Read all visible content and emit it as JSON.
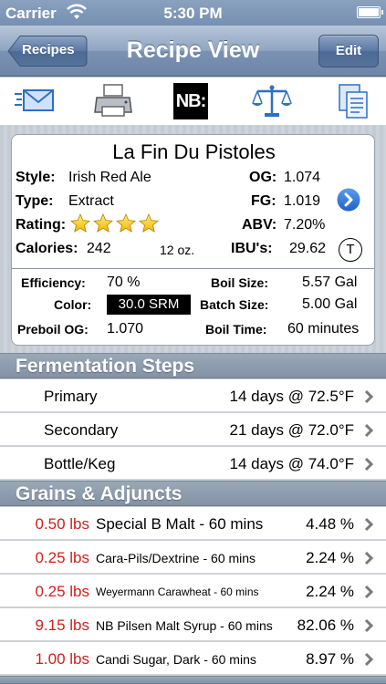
{
  "status": {
    "carrier": "Carrier",
    "time": "5:30 PM"
  },
  "nav": {
    "back_label": "Recipes",
    "title": "Recipe View",
    "edit_label": "Edit"
  },
  "toolbar": {
    "icons": [
      "mail-icon",
      "printer-icon",
      "nb-logo-icon",
      "scale-icon",
      "copy-icon"
    ],
    "nb_text": "NB:"
  },
  "recipe": {
    "name": "La Fin Du Pistoles",
    "style_label": "Style:",
    "style": "Irish Red Ale",
    "type_label": "Type:",
    "type": "Extract",
    "rating_label": "Rating:",
    "rating": 4,
    "calories_label": "Calories:",
    "calories": "242",
    "serving": "12 oz.",
    "og_label": "OG:",
    "og": "1.074",
    "fg_label": "FG:",
    "fg": "1.019",
    "abv_label": "ABV:",
    "abv": "7.20%",
    "ibu_label": "IBU's:",
    "ibu": "29.62",
    "t_label": "T",
    "efficiency_label": "Efficiency:",
    "efficiency": "70 %",
    "color_label": "Color:",
    "color": "30.0 SRM",
    "preboil_label": "Preboil OG:",
    "preboil": "1.070",
    "boil_size_label": "Boil Size:",
    "boil_size": "5.57 Gal",
    "batch_size_label": "Batch Size:",
    "batch_size": "5.00 Gal",
    "boil_time_label": "Boil Time:",
    "boil_time": "60 minutes"
  },
  "fermentation": {
    "header": "Fermentation Steps",
    "steps": [
      {
        "name": "Primary",
        "detail": "14 days @ 72.5°F"
      },
      {
        "name": "Secondary",
        "detail": "21 days @ 72.0°F"
      },
      {
        "name": "Bottle/Keg",
        "detail": "14 days @ 74.0°F"
      }
    ]
  },
  "grains": {
    "header": "Grains & Adjuncts",
    "items": [
      {
        "amount": "0.50 lbs",
        "name": "Special B Malt - 60 mins",
        "percent": "4.48 %"
      },
      {
        "amount": "0.25 lbs",
        "name": "Cara-Pils/Dextrine - 60 mins",
        "percent": "2.24 %"
      },
      {
        "amount": "0.25 lbs",
        "name": "Weyermann Carawheat - 60 mins",
        "percent": "2.24 %"
      },
      {
        "amount": "9.15 lbs",
        "name": "NB Pilsen Malt Syrup - 60 mins",
        "percent": "82.06 %"
      },
      {
        "amount": "1.00 lbs",
        "name": "Candi Sugar, Dark - 60 mins",
        "percent": "8.97 %"
      }
    ]
  },
  "colors": {
    "accent_red": "#d1201a",
    "nav_blue": "#7a92b4",
    "link_blue": "#2a6fd6"
  }
}
